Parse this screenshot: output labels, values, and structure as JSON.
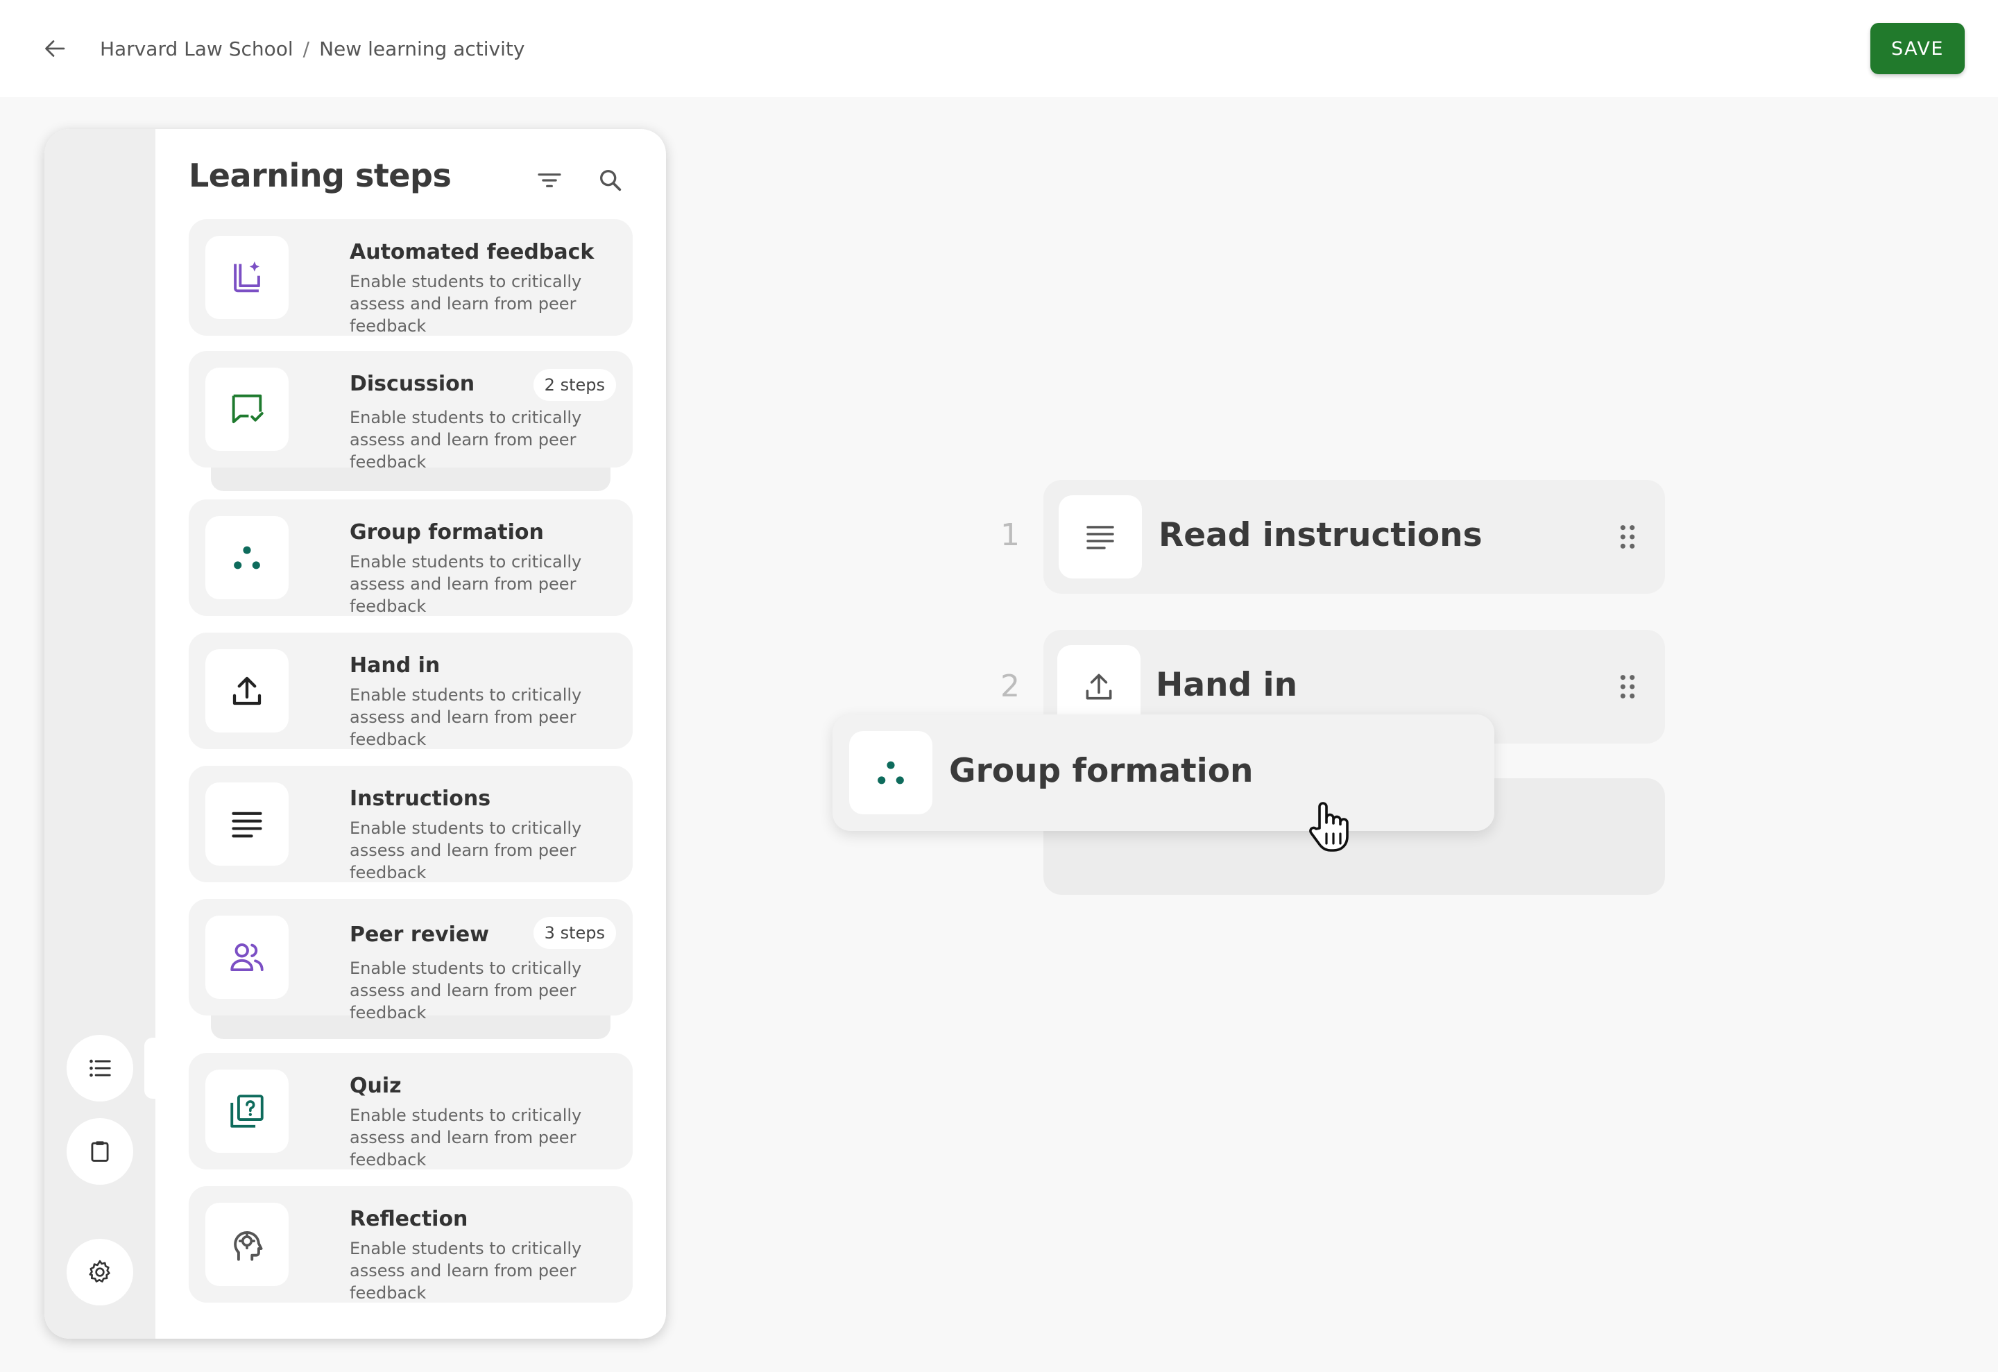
{
  "header": {
    "breadcrumb": [
      "Harvard Law School",
      "New learning activity"
    ],
    "breadcrumb_separator": "/",
    "save_label": "SAVE"
  },
  "colors": {
    "brand_green": "#217a2c",
    "teal": "#0e6b5c",
    "purple": "#7b4fc4",
    "dark_green": "#1e7a2e"
  },
  "panel": {
    "title": "Learning steps",
    "rail_icons": [
      "list-icon",
      "clipboard-icon",
      "gear-icon"
    ],
    "steps": [
      {
        "title": "Automated feedback",
        "desc": "Enable students to critically assess and learn from peer feedback",
        "badge": "",
        "icon": "automated-feedback-icon"
      },
      {
        "title": "Discussion",
        "desc": "Enable students to critically assess and learn from peer feedback",
        "badge": "2 steps",
        "icon": "chat-check-icon"
      },
      {
        "title": "Group formation",
        "desc": "Enable students to critically assess and learn from peer feedback",
        "badge": "",
        "icon": "three-dots-icon"
      },
      {
        "title": "Hand in",
        "desc": "Enable students to critically assess and learn from peer feedback",
        "badge": "",
        "icon": "upload-icon"
      },
      {
        "title": "Instructions",
        "desc": "Enable students to critically assess and learn from peer feedback",
        "badge": "",
        "icon": "lines-icon"
      },
      {
        "title": "Peer review",
        "desc": "Enable students to critically assess and learn from peer feedback",
        "badge": "3 steps",
        "icon": "people-icon"
      },
      {
        "title": "Quiz",
        "desc": "Enable students to critically assess and learn from peer feedback",
        "badge": "",
        "icon": "quiz-icon"
      },
      {
        "title": "Reflection",
        "desc": "Enable students to critically assess and learn from peer feedback",
        "badge": "",
        "icon": "head-gear-icon"
      }
    ]
  },
  "sequence": {
    "items": [
      {
        "number": "1",
        "title": "Read instructions",
        "icon": "lines-icon"
      },
      {
        "number": "2",
        "title": "Hand in",
        "icon": "upload-icon"
      }
    ],
    "dragging": {
      "title": "Group formation",
      "icon": "three-dots-icon"
    }
  }
}
